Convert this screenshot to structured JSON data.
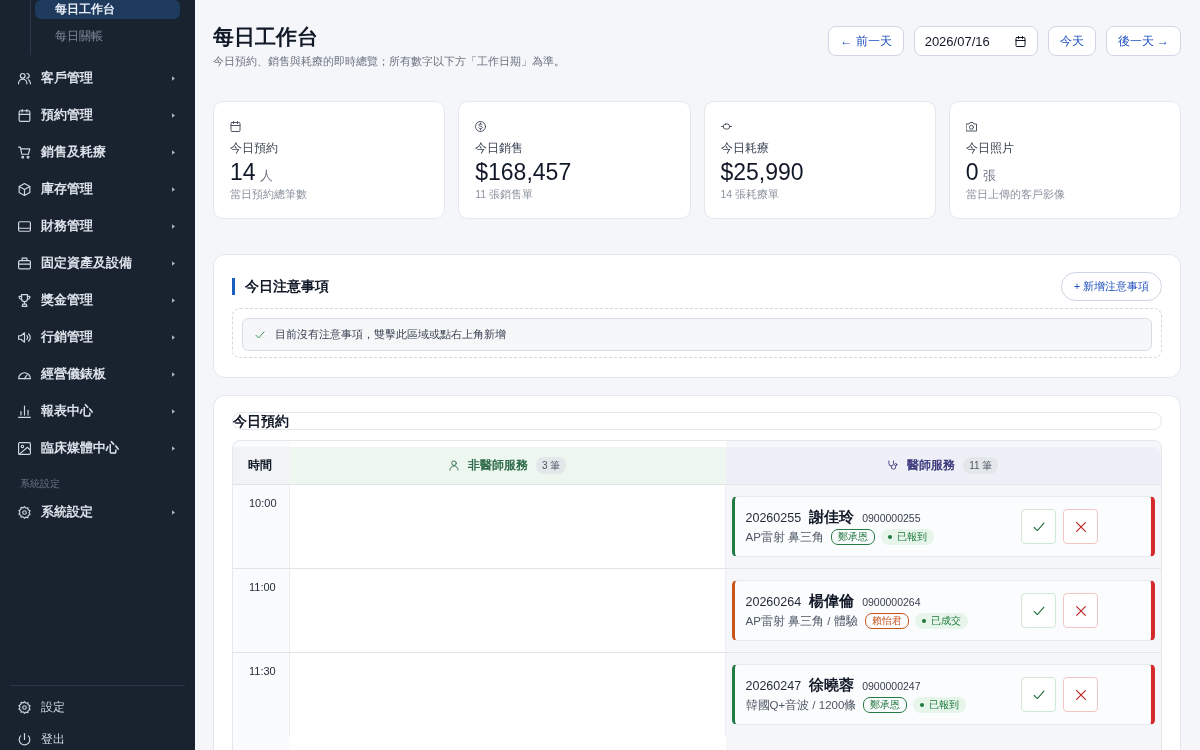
{
  "sidebar": {
    "sub_items": [
      {
        "label": "每日工作台",
        "selected": true
      },
      {
        "label": "每日關帳",
        "selected": false
      }
    ],
    "items": [
      {
        "label": "客戶管理",
        "expanded": false
      },
      {
        "label": "預約管理",
        "expanded": false
      },
      {
        "label": "銷售及耗療",
        "expanded": false
      },
      {
        "label": "庫存管理",
        "expanded": false
      },
      {
        "label": "財務管理",
        "expanded": false
      },
      {
        "label": "固定資產及設備",
        "expanded": false
      },
      {
        "label": "獎金管理",
        "expanded": false
      },
      {
        "label": "行銷管理",
        "expanded": false
      },
      {
        "label": "經營儀錶板",
        "expanded": false
      },
      {
        "label": "報表中心",
        "expanded": false
      },
      {
        "label": "臨床媒體中心",
        "expanded": false
      }
    ],
    "section_label": "系統設定",
    "section_items": [
      {
        "label": "系統設定",
        "expanded": false
      }
    ],
    "footer_items": [
      {
        "label": "設定"
      },
      {
        "label": "登出"
      }
    ]
  },
  "header": {
    "title": "每日工作台",
    "subtitle": "今日預約、銷售與耗療的即時總覽；所有數字以下方「工作日期」為準。",
    "prev_button": "← 前一天",
    "date": "2026/07/16",
    "today_button": "今天",
    "next_button": "後一天 →"
  },
  "stats": [
    {
      "label": "今日預約",
      "value": "14",
      "unit": "人",
      "note": "當日預約總筆數"
    },
    {
      "label": "今日銷售",
      "value": "$168,457",
      "note": "11 張銷售單"
    },
    {
      "label": "今日耗療",
      "value": "$25,990",
      "note": "14 張耗療單"
    },
    {
      "label": "今日照片",
      "value": "0",
      "unit": "張",
      "note": "當日上傳的客戶影像"
    }
  ],
  "notes": {
    "title": "今日注意事項",
    "add_button": "+ 新增注意事項",
    "empty_message": "目前沒有注意事項，雙擊此區域或點右上角新增"
  },
  "appointments": {
    "title": "今日預約",
    "time_header": "時間",
    "columns": [
      {
        "label": "非醫師服務",
        "count": "3 筆"
      },
      {
        "label": "醫師服務",
        "count": "11 筆"
      }
    ],
    "slots": [
      {
        "time": "10:00",
        "doctor": [
          {
            "id": "20260255",
            "name": "謝佳玲",
            "phone": "0900000255",
            "service": "AP雷射 鼻三角",
            "staff": "鄭承恩",
            "color": "#237a43",
            "status": "已報到"
          }
        ]
      },
      {
        "time": "11:00",
        "doctor": [
          {
            "id": "20260264",
            "name": "楊偉倫",
            "phone": "0900000264",
            "service": "AP雷射 鼻三角 / 體驗",
            "staff": "賴怡君",
            "color": "#c9541c",
            "status": "已成交"
          }
        ]
      },
      {
        "time": "11:30",
        "doctor": [
          {
            "id": "20260247",
            "name": "徐曉蓉",
            "phone": "0900000247",
            "service": "韓國Q+音波 / 1200條",
            "staff": "鄭承恩",
            "color": "#237a43",
            "status": "已報到"
          }
        ]
      }
    ]
  }
}
